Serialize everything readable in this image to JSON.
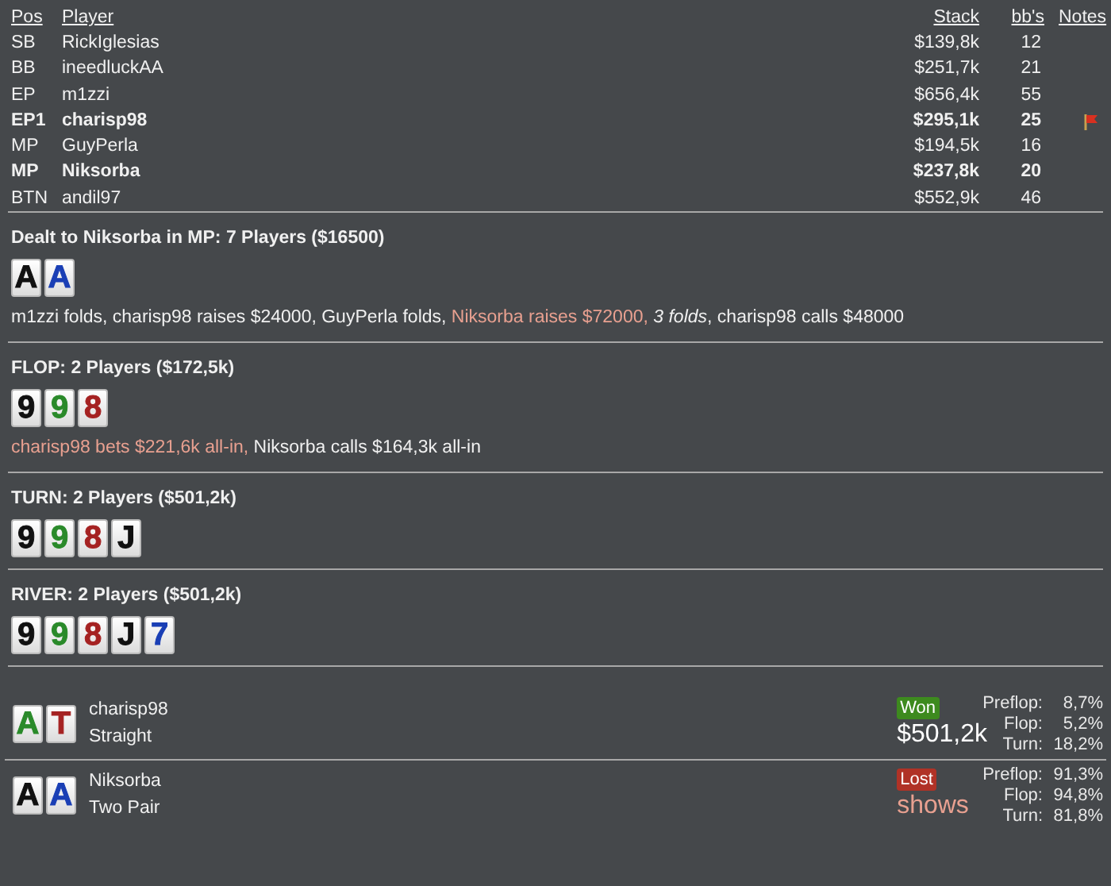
{
  "players_table": {
    "columns": [
      "Pos",
      "Player",
      "Stack",
      "bb's",
      "Notes"
    ],
    "rows": [
      {
        "pos": "SB",
        "name": "RickIglesias",
        "stack": "$139,8k",
        "bbs": "12",
        "bold": false,
        "flagged": false
      },
      {
        "pos": "BB",
        "name": "ineedluckAA",
        "stack": "$251,7k",
        "bbs": "21",
        "bold": false,
        "flagged": false
      },
      {
        "pos": "EP",
        "name": "m1zzi",
        "stack": "$656,4k",
        "bbs": "55",
        "bold": false,
        "flagged": false
      },
      {
        "pos": "EP1",
        "name": "charisp98",
        "stack": "$295,1k",
        "bbs": "25",
        "bold": true,
        "flagged": true
      },
      {
        "pos": "MP",
        "name": "GuyPerla",
        "stack": "$194,5k",
        "bbs": "16",
        "bold": false,
        "flagged": false
      },
      {
        "pos": "MP",
        "name": "Niksorba",
        "stack": "$237,8k",
        "bbs": "20",
        "bold": true,
        "flagged": false
      },
      {
        "pos": "BTN",
        "name": "andil97",
        "stack": "$552,9k",
        "bbs": "46",
        "bold": false,
        "flagged": false
      }
    ]
  },
  "streets": [
    {
      "title": "Dealt to Niksorba in MP: 7 Players ($16500)",
      "cards": [
        {
          "rank": "A",
          "color": "#111111"
        },
        {
          "rank": "A",
          "color": "#1a3fb5"
        }
      ],
      "action": [
        {
          "text": "m1zzi folds, charisp98 raises $24000, GuyPerla folds, ",
          "kind": "plain"
        },
        {
          "text": "Niksorba raises $72000, ",
          "kind": "hero"
        },
        {
          "text": "3 folds",
          "kind": "italic"
        },
        {
          "text": ", charisp98 calls $48000",
          "kind": "plain"
        }
      ]
    },
    {
      "title": "FLOP: 2 Players ($172,5k)",
      "cards": [
        {
          "rank": "9",
          "color": "#111111"
        },
        {
          "rank": "9",
          "color": "#2a8a2a"
        },
        {
          "rank": "8",
          "color": "#a52222"
        }
      ],
      "action": [
        {
          "text": "charisp98 bets $221,6k all-in,",
          "kind": "hero"
        },
        {
          "text": " Niksorba calls $164,3k all-in",
          "kind": "plain"
        }
      ]
    },
    {
      "title": "TURN: 2 Players ($501,2k)",
      "cards": [
        {
          "rank": "9",
          "color": "#111111"
        },
        {
          "rank": "9",
          "color": "#2a8a2a"
        },
        {
          "rank": "8",
          "color": "#a52222"
        },
        {
          "rank": "J",
          "color": "#111111"
        }
      ]
    },
    {
      "title": "RIVER: 2 Players ($501,2k)",
      "cards": [
        {
          "rank": "9",
          "color": "#111111"
        },
        {
          "rank": "9",
          "color": "#2a8a2a"
        },
        {
          "rank": "8",
          "color": "#a52222"
        },
        {
          "rank": "J",
          "color": "#111111"
        },
        {
          "rank": "7",
          "color": "#1a3fb5"
        }
      ]
    }
  ],
  "showdown": [
    {
      "cards": [
        {
          "rank": "A",
          "color": "#2a8a2a"
        },
        {
          "rank": "T",
          "color": "#a52222"
        }
      ],
      "name": "charisp98",
      "hand": "Straight",
      "won": true,
      "badge": "Won",
      "result_text": "$501,2k",
      "equity": [
        {
          "label": "Preflop:",
          "value": "8,7%"
        },
        {
          "label": "Flop:",
          "value": "5,2%"
        },
        {
          "label": "Turn:",
          "value": "18,2%"
        }
      ]
    },
    {
      "cards": [
        {
          "rank": "A",
          "color": "#111111"
        },
        {
          "rank": "A",
          "color": "#1a3fb5"
        }
      ],
      "name": "Niksorba",
      "hand": "Two Pair",
      "won": false,
      "badge": "Lost",
      "result_text": "shows",
      "equity": [
        {
          "label": "Preflop:",
          "value": "91,3%"
        },
        {
          "label": "Flop:",
          "value": "94,8%"
        },
        {
          "label": "Turn:",
          "value": "81,8%"
        }
      ]
    }
  ]
}
